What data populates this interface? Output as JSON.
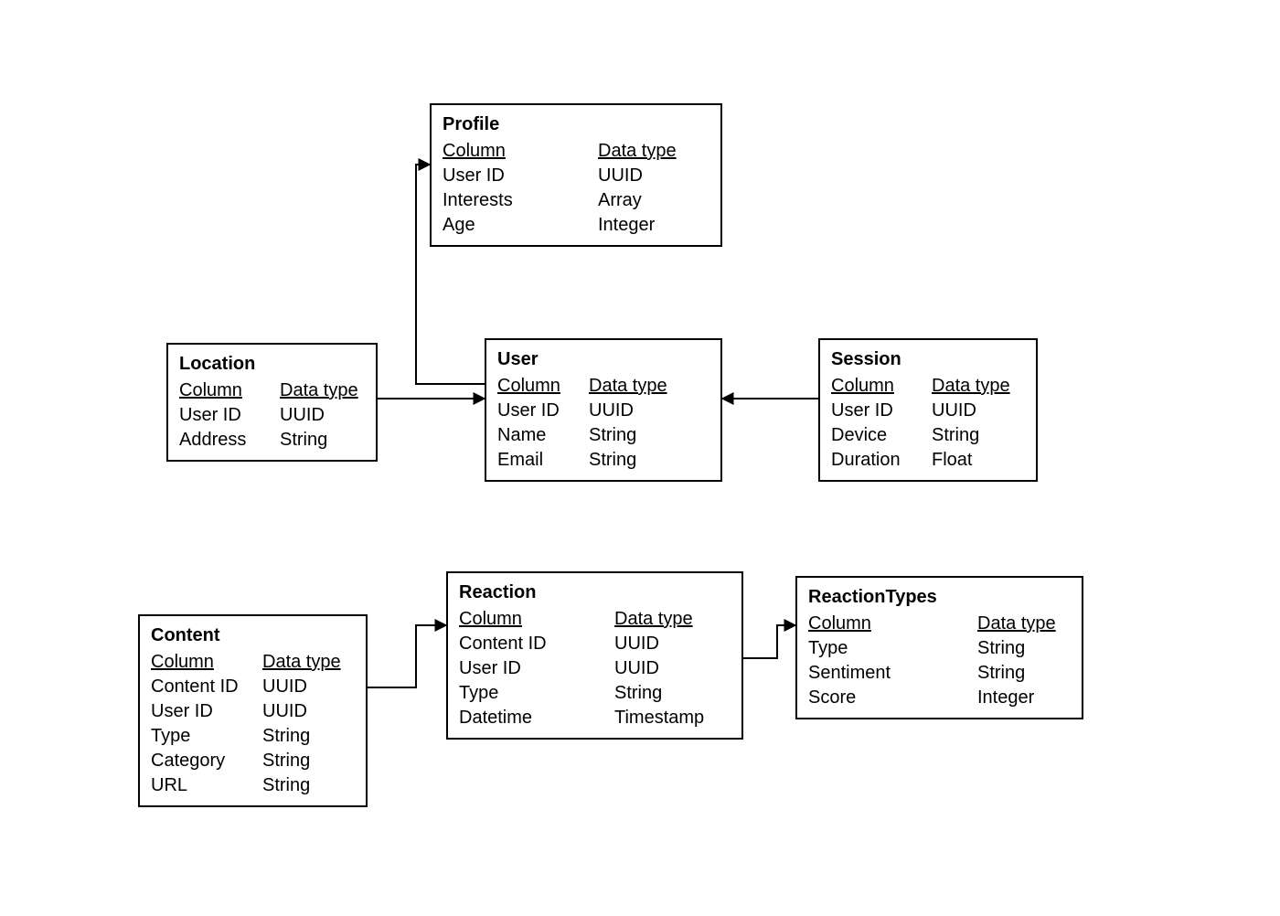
{
  "headers": {
    "column": "Column",
    "datatype": "Data type"
  },
  "entities": {
    "profile": {
      "title": "Profile",
      "rows": [
        {
          "name": "User ID",
          "type": "UUID"
        },
        {
          "name": "Interests",
          "type": "Array"
        },
        {
          "name": "Age",
          "type": "Integer"
        }
      ]
    },
    "location": {
      "title": "Location",
      "rows": [
        {
          "name": "User ID",
          "type": "UUID"
        },
        {
          "name": "Address",
          "type": "String"
        }
      ]
    },
    "user": {
      "title": "User",
      "rows": [
        {
          "name": "User ID",
          "type": "UUID"
        },
        {
          "name": "Name",
          "type": "String"
        },
        {
          "name": "Email",
          "type": "String"
        }
      ]
    },
    "session": {
      "title": "Session",
      "rows": [
        {
          "name": "User ID",
          "type": "UUID"
        },
        {
          "name": "Device",
          "type": "String"
        },
        {
          "name": "Duration",
          "type": "Float"
        }
      ]
    },
    "content": {
      "title": "Content",
      "rows": [
        {
          "name": "Content ID",
          "type": "UUID"
        },
        {
          "name": "User ID",
          "type": "UUID"
        },
        {
          "name": "Type",
          "type": "String"
        },
        {
          "name": "Category",
          "type": "String"
        },
        {
          "name": "URL",
          "type": "String"
        }
      ]
    },
    "reaction": {
      "title": "Reaction",
      "rows": [
        {
          "name": "Content ID",
          "type": "UUID"
        },
        {
          "name": "User ID",
          "type": "UUID"
        },
        {
          "name": "Type",
          "type": "String"
        },
        {
          "name": "Datetime",
          "type": "Timestamp"
        }
      ]
    },
    "reactiontypes": {
      "title": "ReactionTypes",
      "rows": [
        {
          "name": "Type",
          "type": "String"
        },
        {
          "name": "Sentiment",
          "type": "String"
        },
        {
          "name": "Score",
          "type": "Integer"
        }
      ]
    }
  }
}
